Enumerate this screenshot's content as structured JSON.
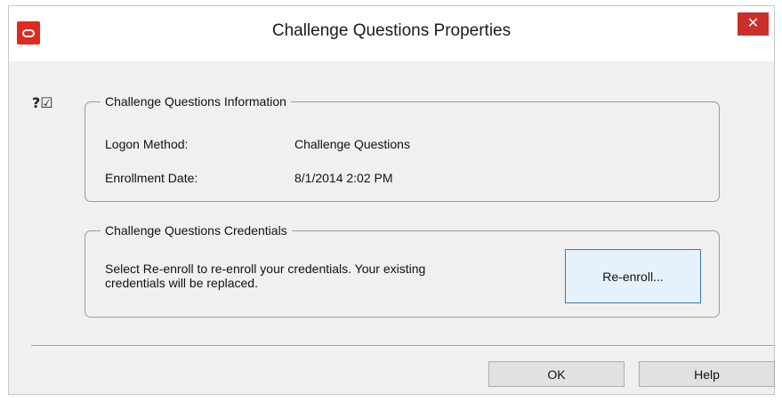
{
  "window": {
    "title": "Challenge Questions Properties",
    "close_label": "✕"
  },
  "icons": {
    "badge": "?☑"
  },
  "info_group": {
    "legend": "Challenge Questions Information",
    "logon_method_label": "Logon Method:",
    "logon_method_value": "Challenge Questions",
    "enrollment_date_label": "Enrollment Date:",
    "enrollment_date_value": "8/1/2014 2:02 PM"
  },
  "cred_group": {
    "legend": "Challenge Questions Credentials",
    "description": "Select Re-enroll to re-enroll your credentials. Your existing credentials will be replaced.",
    "reenroll_label": "Re-enroll..."
  },
  "footer": {
    "ok_label": "OK",
    "help_label": "Help"
  },
  "colors": {
    "close_button": "#c9302c",
    "app_logo": "#e02a1f",
    "focused_button_border": "#3c7fb1"
  }
}
